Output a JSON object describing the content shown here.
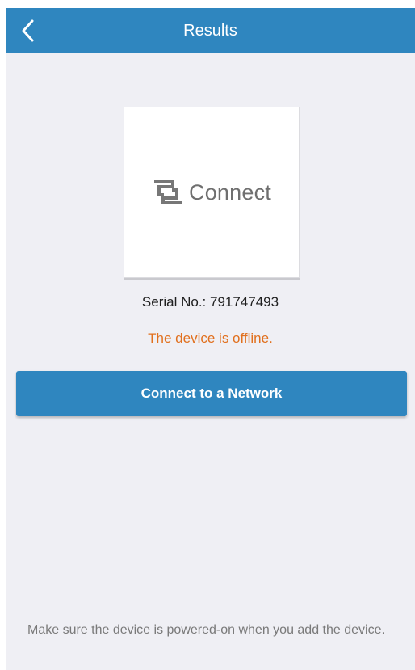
{
  "header": {
    "title": "Results",
    "back_icon": "chevron-left-icon"
  },
  "device": {
    "logo_text": "Connect",
    "logo_icon": "connect-logo-icon",
    "serial_label": "Serial No.: 791747493",
    "status_text": "The device is offline."
  },
  "actions": {
    "connect_label": "Connect to a Network"
  },
  "footer": {
    "note": "Make sure the device is powered-on when you add the device."
  },
  "colors": {
    "accent": "#2f86bf",
    "background": "#efeff4",
    "status_offline": "#e1701e",
    "muted_text": "#7a7a7a"
  }
}
